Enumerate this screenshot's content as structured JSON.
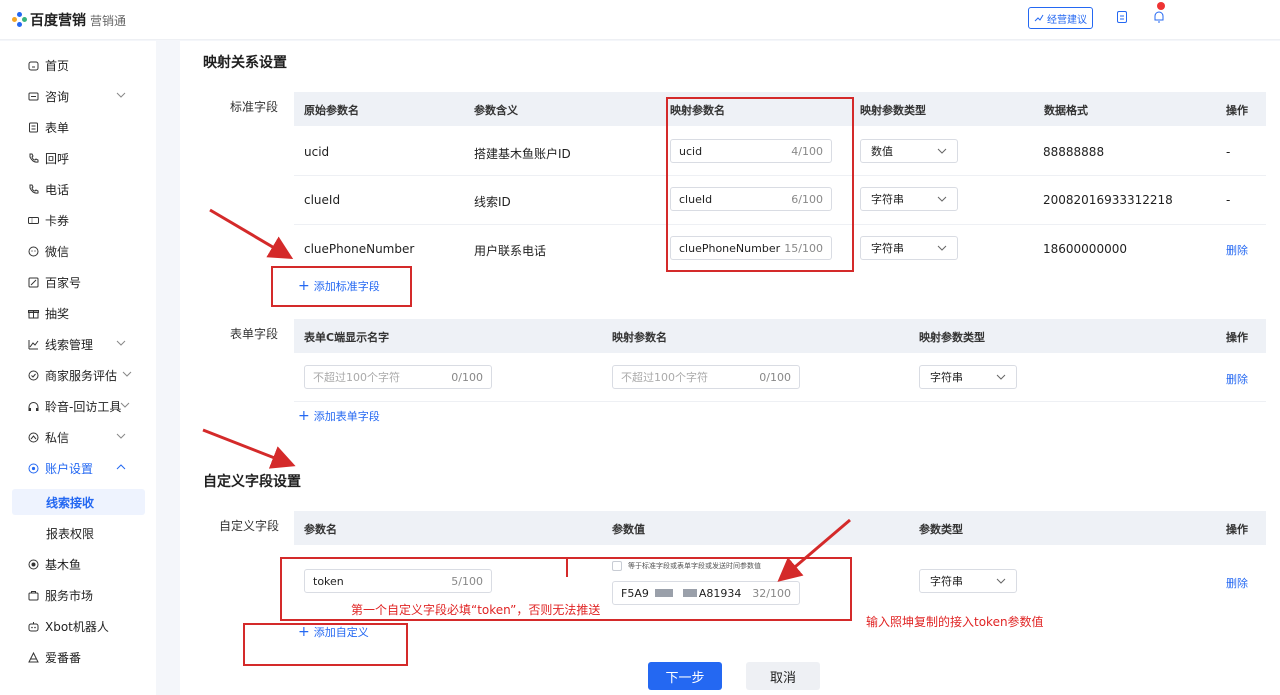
{
  "header": {
    "logo_main": "百度营销",
    "logo_sub": "营销通",
    "advice_button": "经营建议",
    "notification_count": "",
    "colors": {
      "brand": "#2468f2",
      "badge": "#e33333"
    }
  },
  "sidebar": {
    "items": [
      {
        "label": "首页",
        "icon": "home-icon"
      },
      {
        "label": "咨询",
        "icon": "chat-icon",
        "expandable": true
      },
      {
        "label": "表单",
        "icon": "form-icon"
      },
      {
        "label": "回呼",
        "icon": "callback-icon"
      },
      {
        "label": "电话",
        "icon": "phone-icon"
      },
      {
        "label": "卡券",
        "icon": "coupon-icon"
      },
      {
        "label": "微信",
        "icon": "wechat-icon"
      },
      {
        "label": "百家号",
        "icon": "baijiahao-icon"
      },
      {
        "label": "抽奖",
        "icon": "gift-icon"
      },
      {
        "label": "线索管理",
        "icon": "chart-icon",
        "expandable": true
      },
      {
        "label": "商家服务评估",
        "icon": "shield-icon",
        "expandable": true
      },
      {
        "label": "聆音-回访工具",
        "icon": "headset-icon",
        "expandable": true
      },
      {
        "label": "私信",
        "icon": "message-icon",
        "expandable": true
      },
      {
        "label": "账户设置",
        "icon": "settings-icon",
        "expandable": true,
        "active": true
      }
    ],
    "sub_items": [
      {
        "label": "线索接收",
        "selected": true
      },
      {
        "label": "报表权限"
      }
    ],
    "bottom_items": [
      {
        "label": "基木鱼",
        "icon": "fish-icon"
      },
      {
        "label": "服务市场",
        "icon": "market-icon"
      },
      {
        "label": "Xbot机器人",
        "icon": "robot-icon"
      },
      {
        "label": "爱番番",
        "icon": "aifanfan-icon"
      }
    ]
  },
  "mapping": {
    "title": "映射关系设置",
    "standard": {
      "label": "标准字段",
      "headers": [
        "原始参数名",
        "参数含义",
        "映射参数名",
        "映射参数类型",
        "数据格式",
        "操作"
      ],
      "rows": [
        {
          "name": "ucid",
          "meaning": "搭建基木鱼账户ID",
          "mapped": "ucid",
          "count": "4/100",
          "type": "数值",
          "format": "88888888",
          "action": "-"
        },
        {
          "name": "clueId",
          "meaning": "线索ID",
          "mapped": "clueId",
          "count": "6/100",
          "type": "字符串",
          "format": "20082016933312218",
          "action": "-"
        },
        {
          "name": "cluePhoneNumber",
          "meaning": "用户联系电话",
          "mapped": "cluePhoneNumber",
          "count": "15/100",
          "type": "字符串",
          "format": "18600000000",
          "action": "删除"
        }
      ],
      "add_label": "添加标准字段"
    },
    "form": {
      "label": "表单字段",
      "headers": [
        "表单C端显示名字",
        "映射参数名",
        "映射参数类型",
        "操作"
      ],
      "row": {
        "name_placeholder": "不超过100个字符",
        "name_count": "0/100",
        "mapped_placeholder": "不超过100个字符",
        "mapped_count": "0/100",
        "type": "字符串",
        "action": "删除"
      },
      "add_label": "添加表单字段"
    }
  },
  "custom": {
    "title": "自定义字段设置",
    "label": "自定义字段",
    "headers": [
      "参数名",
      "参数值",
      "参数类型",
      "操作"
    ],
    "row": {
      "name": "token",
      "name_count": "5/100",
      "checkbox_label": "等于标准字段或表单字段或发送时间参数值",
      "value_start": "F5A9",
      "value_end": "A81934",
      "value_count": "32/100",
      "type": "字符串",
      "action": "删除"
    },
    "add_label": "添加自定义"
  },
  "footer": {
    "next": "下一步",
    "cancel": "取消"
  },
  "annotations": {
    "note_token": "第一个自定义字段必填“token”，否则无法推送",
    "note_value": "输入照坤复制的接入token参数值",
    "color": "#d42a2a"
  }
}
